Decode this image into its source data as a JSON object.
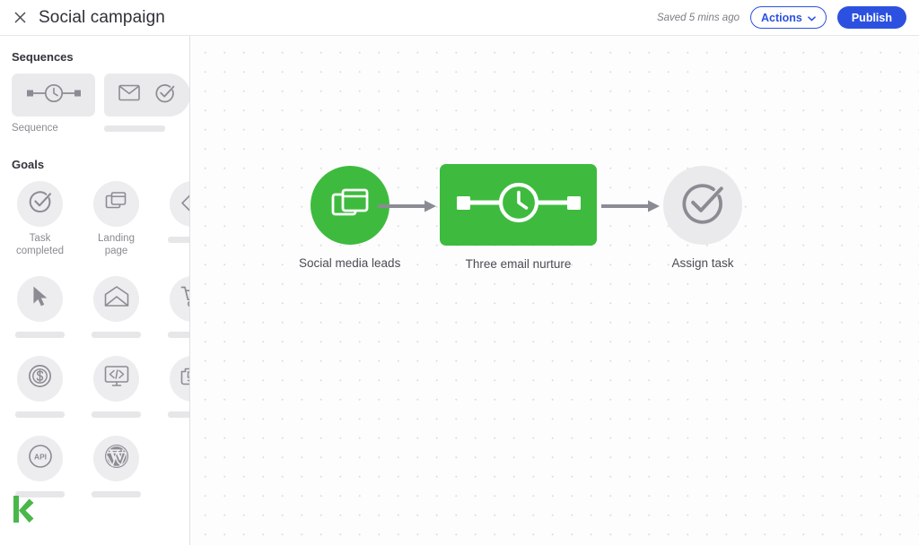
{
  "header": {
    "close_icon": "close-icon",
    "title": "Social campaign",
    "saved_status": "Saved 5 mins ago",
    "actions_label": "Actions",
    "actions_caret_icon": "chevron-down-icon",
    "publish_label": "Publish"
  },
  "sidebar": {
    "sections": [
      {
        "title": "Sequences"
      },
      {
        "title": "Goals"
      }
    ],
    "sequences": [
      {
        "label": "Sequence",
        "icon": "sequence-timer-icon",
        "placeholder": false
      },
      {
        "label": "",
        "icon": "email-check-icon",
        "placeholder": true
      }
    ],
    "goals": [
      {
        "label": "Task completed",
        "icon": "task-completed-icon",
        "placeholder": false
      },
      {
        "label": "Landing page",
        "icon": "landing-page-icon",
        "placeholder": false
      },
      {
        "label": "",
        "icon": "tag-icon",
        "placeholder": true
      },
      {
        "label": "",
        "icon": "cursor-click-icon",
        "placeholder": true
      },
      {
        "label": "",
        "icon": "open-envelope-icon",
        "placeholder": true
      },
      {
        "label": "",
        "icon": "shopping-cart-icon",
        "placeholder": true
      },
      {
        "label": "",
        "icon": "dollar-circle-icon",
        "placeholder": true
      },
      {
        "label": "",
        "icon": "code-monitor-icon",
        "placeholder": true
      },
      {
        "label": "",
        "icon": "newspaper-icon",
        "placeholder": true
      },
      {
        "label": "",
        "icon": "api-circle-icon",
        "placeholder": true
      },
      {
        "label": "",
        "icon": "wordpress-icon",
        "placeholder": true
      }
    ],
    "brand_icon": "keap-logo-icon"
  },
  "canvas": {
    "nodes": [
      {
        "id": "social-media-leads",
        "label": "Social media leads",
        "shape": "circle",
        "state": "active",
        "icon": "landing-page-icon"
      },
      {
        "id": "three-email-nurture",
        "label": "Three email nurture",
        "shape": "box",
        "state": "active",
        "icon": "sequence-timer-icon"
      },
      {
        "id": "assign-task",
        "label": "Assign task",
        "shape": "circle",
        "state": "inactive",
        "icon": "task-completed-icon"
      }
    ],
    "connectors": [
      {
        "from": "social-media-leads",
        "to": "three-email-nurture",
        "icon": "arrow-right-icon"
      },
      {
        "from": "three-email-nurture",
        "to": "assign-task",
        "icon": "arrow-right-icon"
      }
    ]
  },
  "colors": {
    "accent_green": "#3ebb3e",
    "accent_blue": "#2c51e0",
    "inactive_grey": "#eaeaec",
    "icon_grey": "#8b8b93",
    "label_text": "#4b4b55"
  }
}
